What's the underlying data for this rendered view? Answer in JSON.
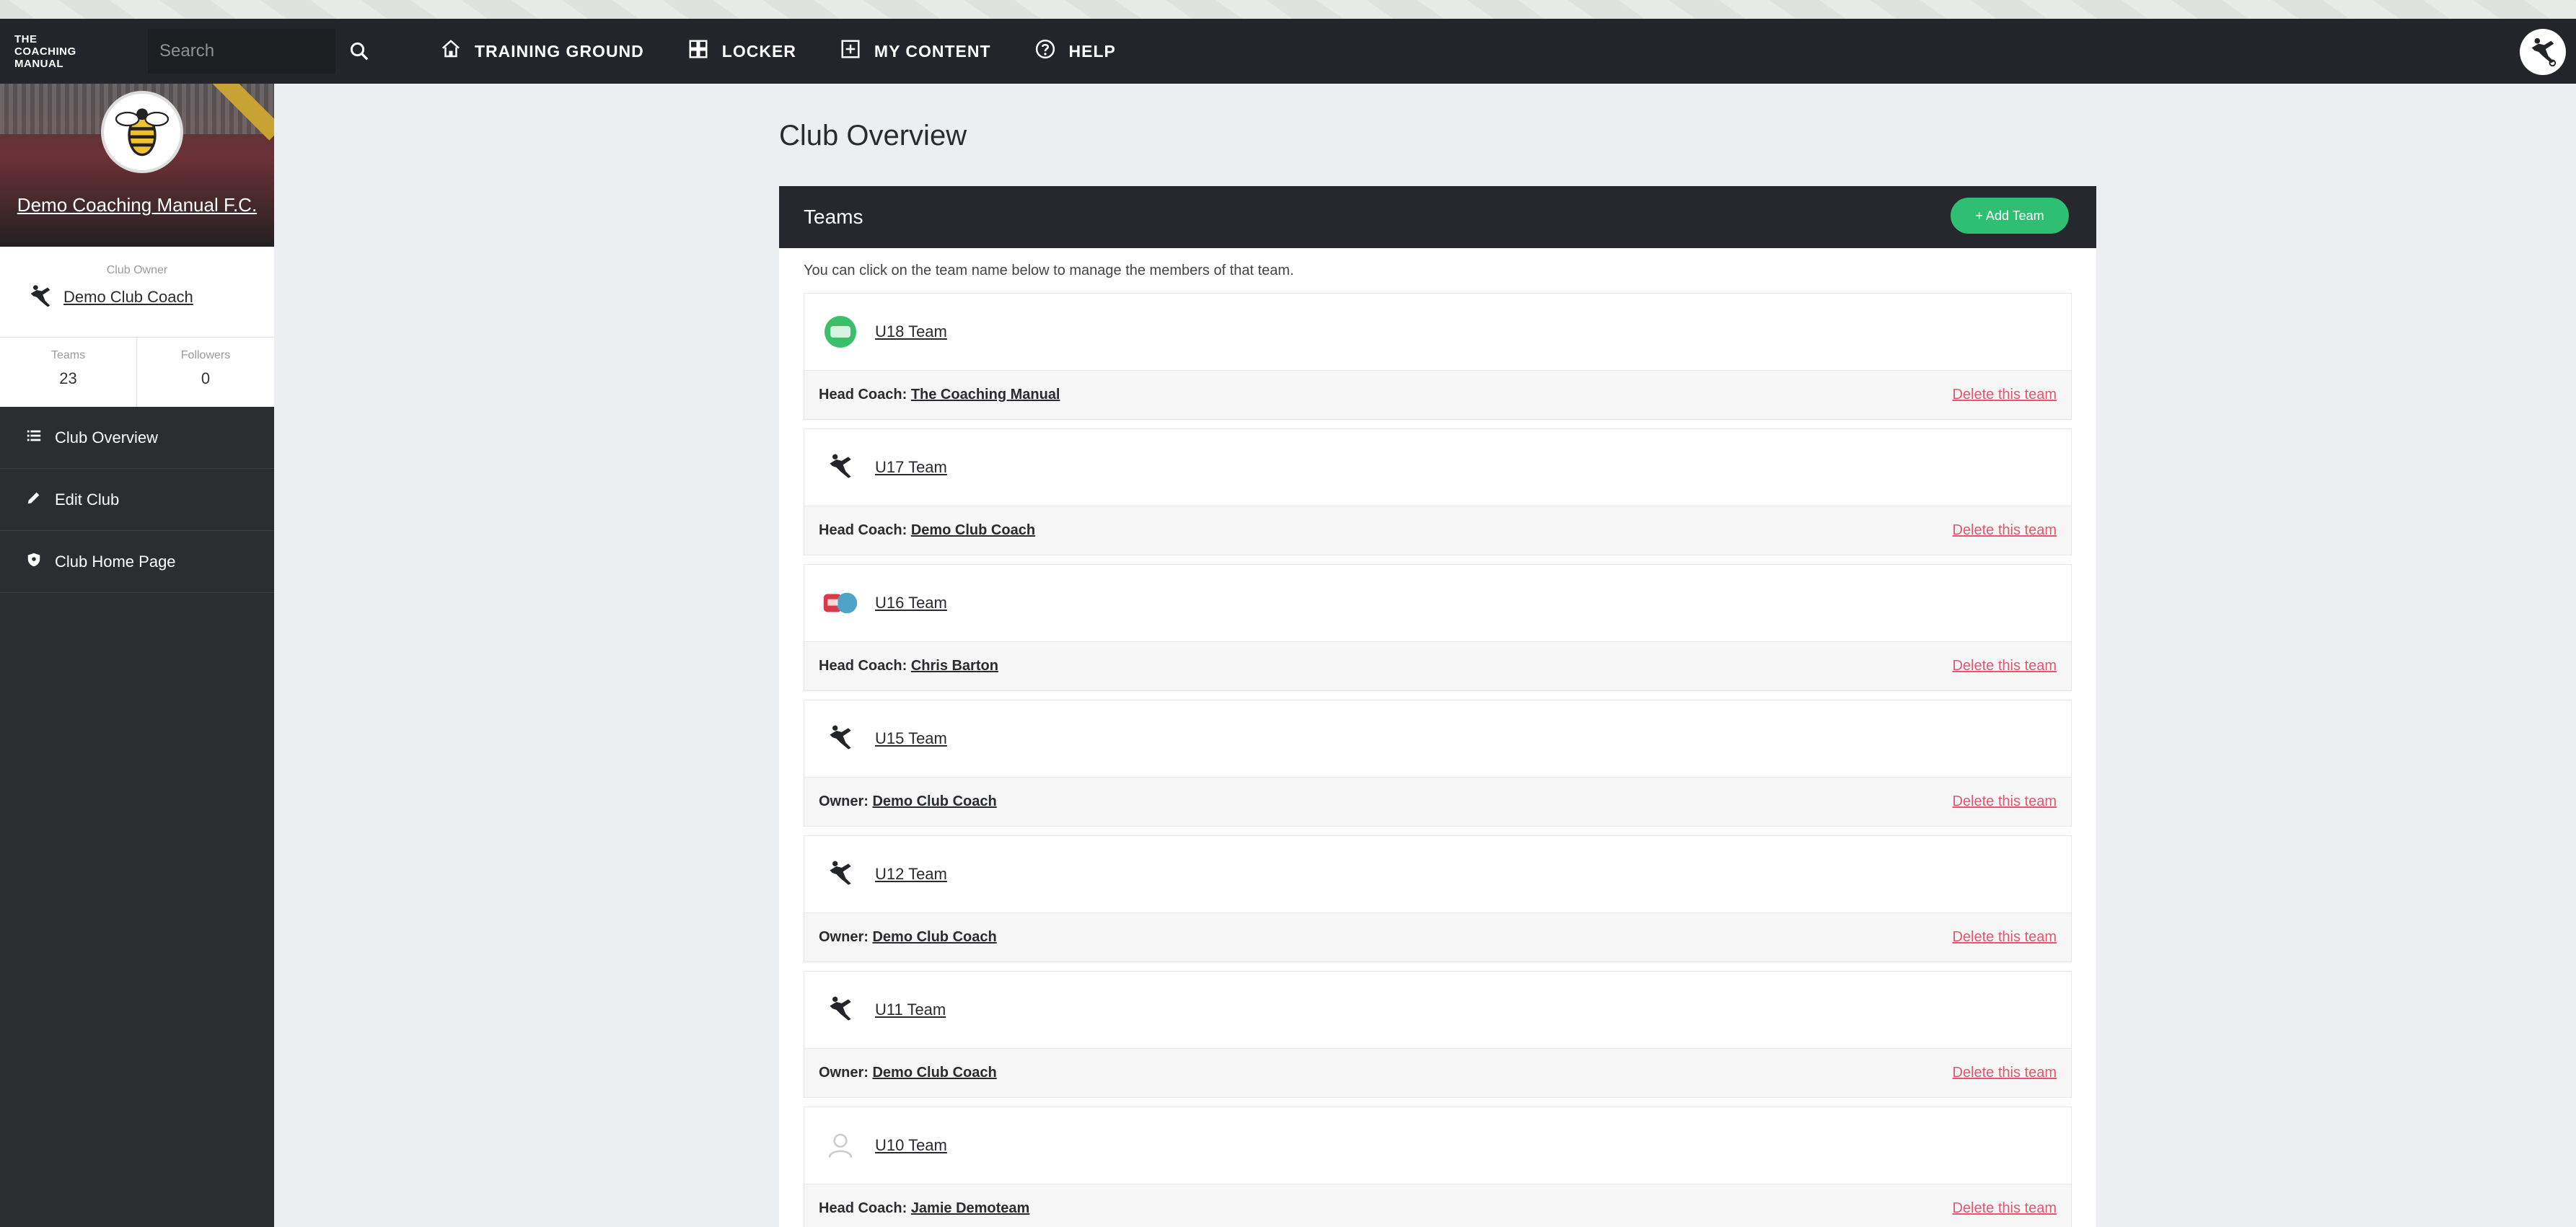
{
  "topbar": {
    "logo_text": "THE COACHING MANUAL",
    "search_placeholder": "Search",
    "nav": [
      {
        "label": "TRAINING GROUND",
        "icon": "home-icon"
      },
      {
        "label": "LOCKER",
        "icon": "locker-icon"
      },
      {
        "label": "MY CONTENT",
        "icon": "plus-square-icon"
      },
      {
        "label": "HELP",
        "icon": "help-icon"
      }
    ]
  },
  "sidebar": {
    "club_name": "Demo Coaching Manual F.C.",
    "owner_label": "Club Owner",
    "owner_name": "Demo Club Coach",
    "stats": [
      {
        "label": "Teams",
        "value": "23"
      },
      {
        "label": "Followers",
        "value": "0"
      }
    ],
    "menu": [
      {
        "label": "Club Overview",
        "icon": "list-icon"
      },
      {
        "label": "Edit Club",
        "icon": "pencil-icon"
      },
      {
        "label": "Club Home Page",
        "icon": "shield-icon"
      }
    ]
  },
  "main": {
    "page_title": "Club Overview",
    "panel_title": "Teams",
    "add_team_label": "+ Add Team",
    "intro": "You can click on the team name below to manage the members of that team.",
    "delete_label": "Delete this team",
    "teams": [
      {
        "name": "U18 Team",
        "role": "Head Coach:",
        "coach": "The Coaching Manual",
        "icon": "green-team-icon"
      },
      {
        "name": "U17 Team",
        "role": "Head Coach:",
        "coach": "Demo Club Coach",
        "icon": "player-icon"
      },
      {
        "name": "U16 Team",
        "role": "Head Coach:",
        "coach": "Chris Barton",
        "icon": "red-team-icon"
      },
      {
        "name": "U15 Team",
        "role": "Owner:",
        "coach": "Demo Club Coach",
        "icon": "player-icon"
      },
      {
        "name": "U12 Team",
        "role": "Owner:",
        "coach": "Demo Club Coach",
        "icon": "player-icon"
      },
      {
        "name": "U11 Team",
        "role": "Owner:",
        "coach": "Demo Club Coach",
        "icon": "player-icon"
      },
      {
        "name": "U10 Team",
        "role": "Head Coach:",
        "coach": "Jamie Demoteam",
        "icon": "user-placeholder-icon"
      }
    ]
  },
  "colors": {
    "topbar": "#23252a",
    "sidebar": "#2b2d31",
    "accent_green": "#2fbf72",
    "delete_red": "#e0586e"
  }
}
